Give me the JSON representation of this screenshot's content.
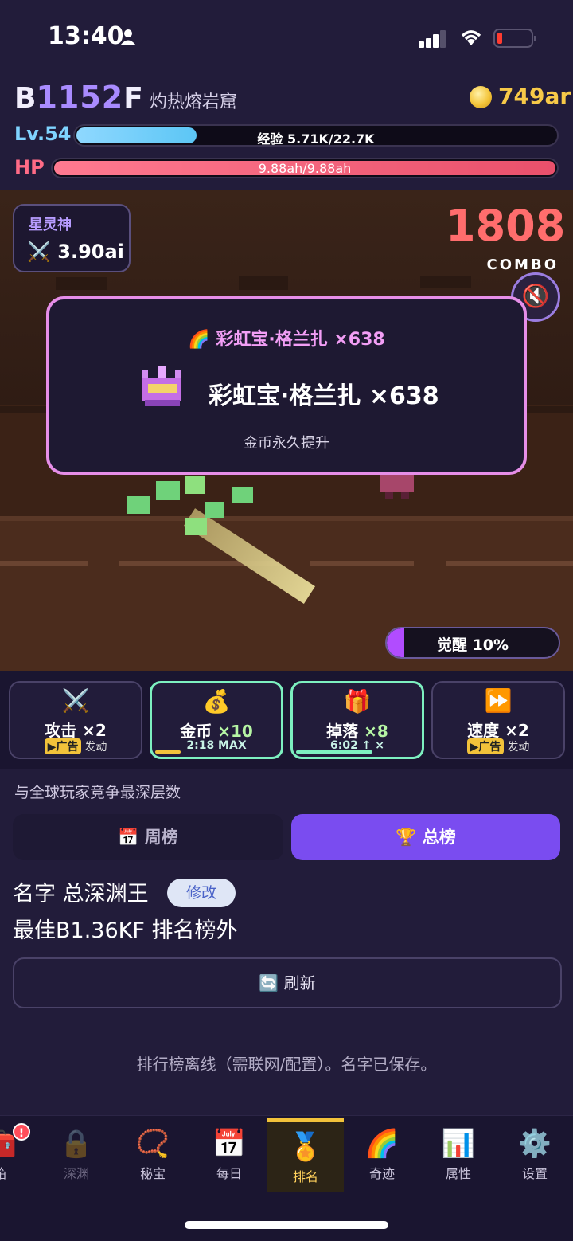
{
  "status": {
    "time": "13:40"
  },
  "header": {
    "floor_prefix": "B",
    "floor_num": "1152",
    "floor_suffix": "F",
    "location": "灼热熔岩窟",
    "gold": "749ar",
    "level": "Lv.54",
    "xp_text": "经验 5.71K/22.7K",
    "xp_fraction": 0.25,
    "hp_label": "HP",
    "hp_text": "9.88ah/9.88ah",
    "hp_fraction": 1.0
  },
  "scene": {
    "hero_name": "星灵神",
    "hero_attack": "3.90ai",
    "combo_count": "1808",
    "combo_label": "COMBO",
    "awaken_text": "觉醒 10%",
    "awaken_fraction": 0.1
  },
  "popup": {
    "title": "彩虹宝·格兰扎 ×638",
    "main": "彩虹宝·格兰扎 ×638",
    "sub": "金币永久提升"
  },
  "buffs": [
    {
      "icon": "⚔️",
      "name": "攻击",
      "mult": "×2",
      "ad": "▶广告",
      "sub": "发动",
      "active": false
    },
    {
      "icon": "💰",
      "name": "金币",
      "mult": "×10",
      "sub": "2:18 MAX",
      "active": true,
      "progress": 0.2
    },
    {
      "icon": "🎁",
      "name": "掉落",
      "mult": "×8",
      "sub": "6:02 ↑ ×",
      "active": true,
      "progress": 0.6
    },
    {
      "icon": "⏩",
      "name": "速度",
      "mult": "×2",
      "ad": "▶广告",
      "sub": "发动",
      "active": false
    }
  ],
  "ranking": {
    "description": "与全球玩家竞争最深层数",
    "tab_week": "周榜",
    "tab_total": "总榜",
    "name_line": "名字 总深渊王",
    "edit_label": "修改",
    "best_line": "最佳B1.36KF 排名榜外",
    "refresh_label": "刷新",
    "offline_note": "排行榜离线（需联网/配置）。名字已保存。"
  },
  "nav": {
    "badge": "!",
    "items": [
      {
        "label": "箱",
        "icon": "🧰"
      },
      {
        "label": "深渊",
        "icon": "🔒"
      },
      {
        "label": "秘宝",
        "icon": "📿"
      },
      {
        "label": "每日",
        "icon": "📅"
      },
      {
        "label": "排名",
        "icon": "🏅"
      },
      {
        "label": "奇迹",
        "icon": "🌈"
      },
      {
        "label": "属性",
        "icon": "📊"
      },
      {
        "label": "设置",
        "icon": "⚙️"
      }
    ]
  },
  "colors": {
    "accent": "#7a4cf0",
    "combo": "#ff6d6d",
    "gold": "#f7c948",
    "xp": "#8fd8ff",
    "hp": "#e9506b",
    "popup_border": "#e68ee8"
  }
}
